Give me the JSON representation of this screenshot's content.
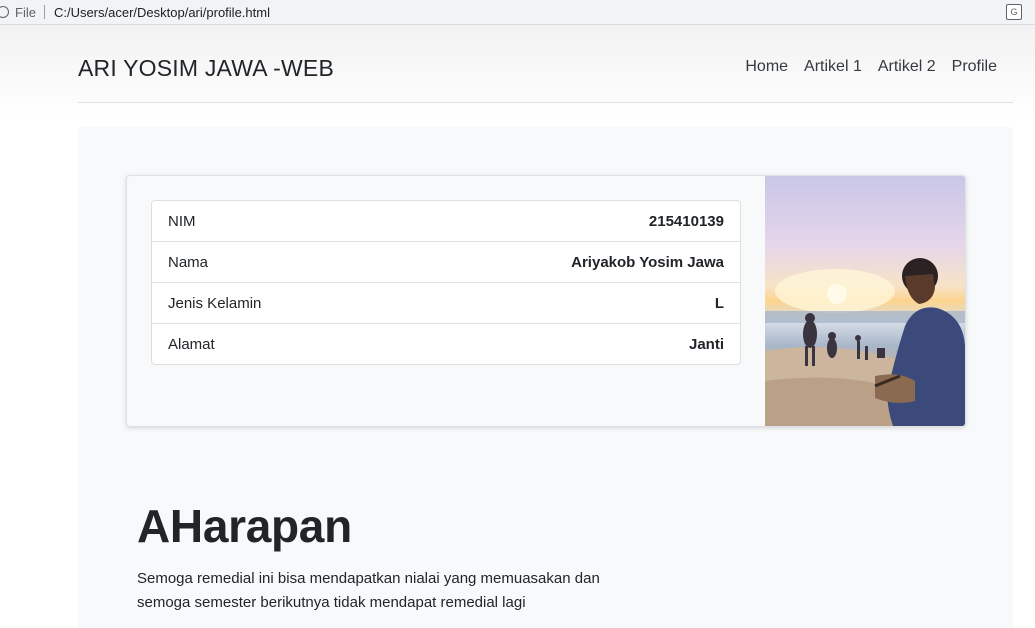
{
  "browser": {
    "scheme": "File",
    "url": "C:/Users/acer/Desktop/ari/profile.html",
    "icons": [
      "info-icon",
      "translate-icon"
    ]
  },
  "navbar": {
    "brand": "ARI YOSIM JAWA -WEB",
    "links": [
      "Home",
      "Artikel 1",
      "Artikel 2",
      "Profile"
    ]
  },
  "profile": {
    "rows": [
      {
        "label": "NIM",
        "value": "215410139"
      },
      {
        "label": "Nama",
        "value": "Ariyakob Yosim Jawa"
      },
      {
        "label": "Jenis Kelamin",
        "value": "L"
      },
      {
        "label": "Alamat",
        "value": "Janti"
      }
    ]
  },
  "section": {
    "heading": "AHarapan",
    "paragraph_line1": "Semoga remedial ini bisa mendapatkan nialai yang memuasakan dan",
    "paragraph_line2": "semoga semester berikutnya tidak mendapat remedial lagi"
  }
}
